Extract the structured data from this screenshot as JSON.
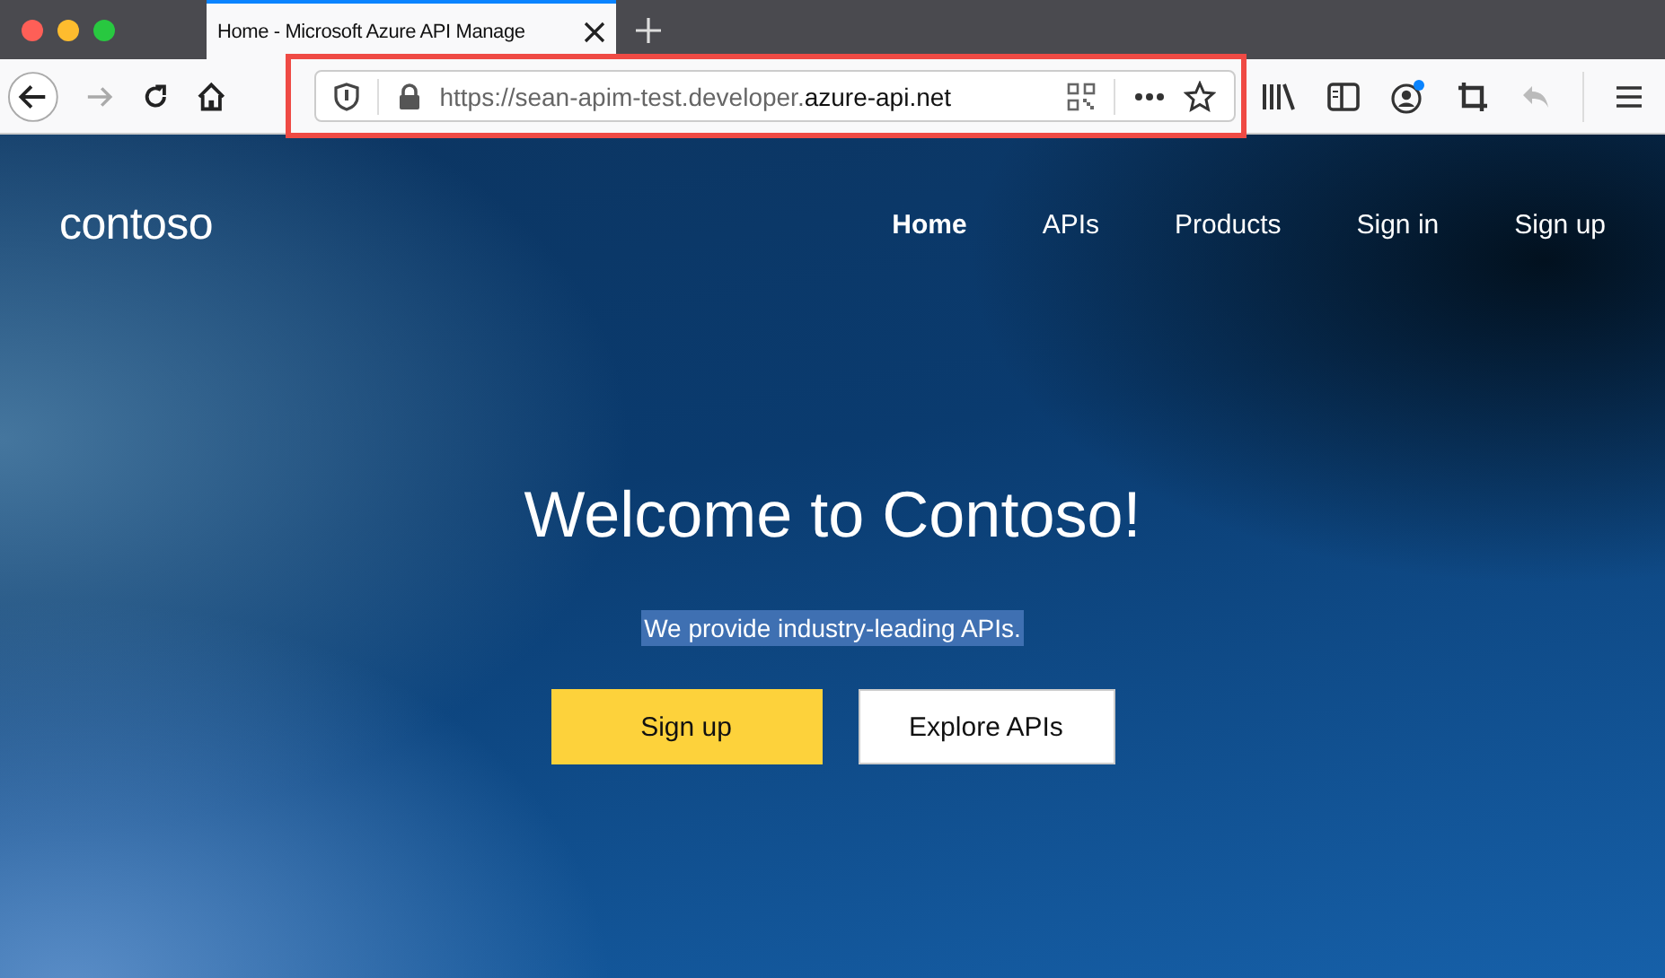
{
  "browser": {
    "tab": {
      "title": "Home - Microsoft Azure API Manage",
      "selected": true
    },
    "url": "https://sean-apim-test.developer.**azure-api.net**",
    "url_highlighted": true,
    "account_notification": true
  },
  "site": {
    "logo": "contoso",
    "nav": [
      {
        "label": "Home",
        "selected": true
      },
      {
        "label": "APIs",
        "selected": false
      },
      {
        "label": "Products",
        "selected": false
      },
      {
        "label": "Sign in",
        "selected": false
      },
      {
        "label": "Sign up",
        "selected": false
      }
    ],
    "hero": {
      "title": "Welcome to Contoso!",
      "tagline": "We provide industry-leading APIs.",
      "tagline_selected": true,
      "buttons": [
        {
          "label": "Sign up",
          "kind": "primary"
        },
        {
          "label": "Explore APIs",
          "kind": "secondary"
        }
      ]
    }
  }
}
